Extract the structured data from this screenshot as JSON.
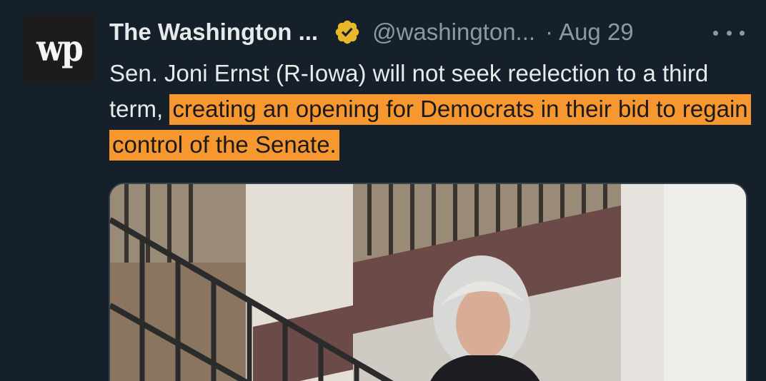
{
  "author": {
    "display_name": "The Washington ...",
    "handle": "@washington...",
    "separator": "·",
    "date": "Aug 29",
    "avatar_icon": "washington-post-wp-logo",
    "avatar_text": "wp",
    "verified_icon": "gold-verified-badge"
  },
  "tweet": {
    "text_plain": "Sen. Joni Ernst (R-Iowa) will not seek reelection to a third term,",
    "text_highlighted": "creating an opening for Democrats in their bid to regain control of the Senate.",
    "highlight_color": "#f7972f"
  },
  "media": {
    "type": "photo"
  },
  "colors": {
    "background": "#15202b",
    "primary_text": "#e7e9ea",
    "secondary_text": "#8b98a5",
    "verified_gold": "#e8b829"
  }
}
